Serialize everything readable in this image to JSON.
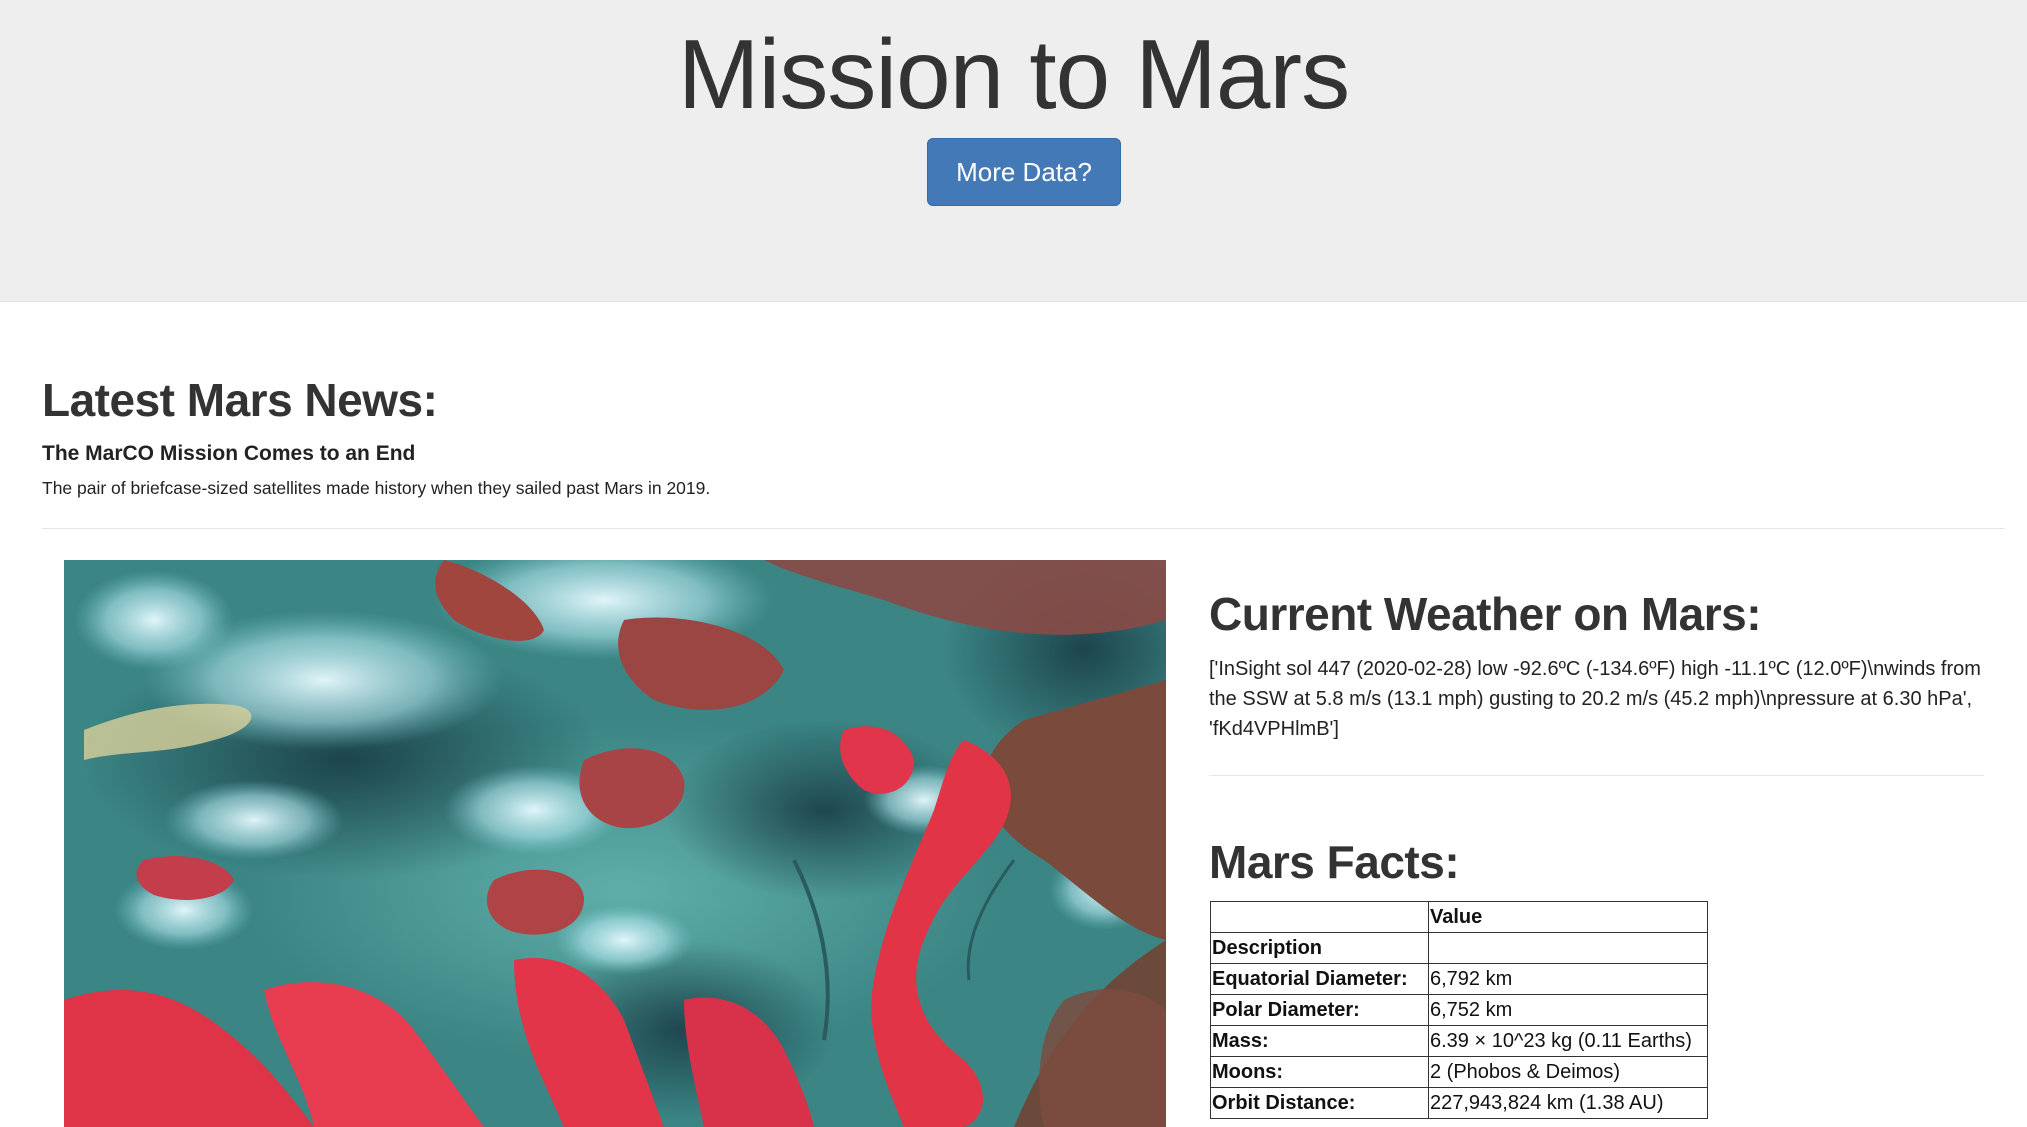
{
  "header": {
    "title": "Mission to Mars",
    "button_label": "More Data?",
    "background": "#eeeeee",
    "button_color": "#4479b7"
  },
  "news": {
    "heading": "Latest Mars News:",
    "title": "The MarCO Mission Comes to an End",
    "teaser": "The pair of briefcase-sized satellites made history when they sailed past Mars in 2019."
  },
  "featured_image": {
    "description_icon": "false-color-satellite-image",
    "colors": [
      "#3c8a86",
      "#e43a4c",
      "#c4eef2",
      "#1f4b52"
    ]
  },
  "weather": {
    "heading": "Current Weather on Mars:",
    "text": "['InSight sol 447 (2020-02-28) low -92.6ºC (-134.6ºF) high -11.1ºC (12.0ºF)\\nwinds from the SSW at 5.8 m/s (13.1 mph) gusting to 20.2 m/s (45.2 mph)\\npressure at 6.30 hPa', 'fKd4VPHlmB']"
  },
  "facts": {
    "heading": "Mars Facts:",
    "columns": [
      "",
      "Value"
    ],
    "rows": [
      {
        "label": "Description",
        "value": ""
      },
      {
        "label": "Equatorial Diameter:",
        "value": "6,792 km"
      },
      {
        "label": "Polar Diameter:",
        "value": "6,752 km"
      },
      {
        "label": "Mass:",
        "value": "6.39 × 10^23 kg (0.11 Earths)"
      },
      {
        "label": "Moons:",
        "value": "2 (Phobos & Deimos)"
      },
      {
        "label": "Orbit Distance:",
        "value": "227,943,824 km (1.38 AU)"
      }
    ]
  }
}
